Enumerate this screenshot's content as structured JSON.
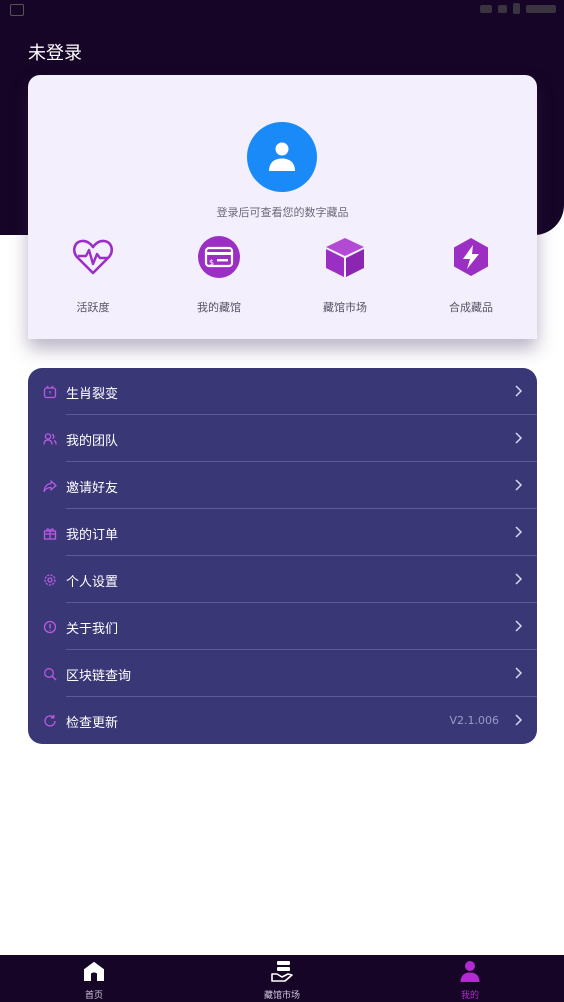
{
  "header": {
    "title": "未登录"
  },
  "profile": {
    "login_hint": "登录后可查看您的数字藏品",
    "features": [
      {
        "label": "活跃度",
        "icon": "heart-pulse-icon"
      },
      {
        "label": "我的藏馆",
        "icon": "wallet-card-icon"
      },
      {
        "label": "藏馆市场",
        "icon": "cube-box-icon"
      },
      {
        "label": "合成藏品",
        "icon": "synthesis-icon"
      }
    ]
  },
  "menu": {
    "items": [
      {
        "label": "生肖裂变",
        "icon": "alarm-clock-icon"
      },
      {
        "label": "我的团队",
        "icon": "team-icon"
      },
      {
        "label": "邀请好友",
        "icon": "share-icon"
      },
      {
        "label": "我的订单",
        "icon": "gift-icon"
      },
      {
        "label": "个人设置",
        "icon": "settings-icon"
      },
      {
        "label": "关于我们",
        "icon": "info-icon"
      },
      {
        "label": "区块链查询",
        "icon": "search-icon"
      },
      {
        "label": "检查更新",
        "icon": "refresh-icon"
      }
    ],
    "version": "V2.1.006"
  },
  "tabbar": {
    "tabs": [
      {
        "label": "首页",
        "icon": "home-icon"
      },
      {
        "label": "藏馆市场",
        "icon": "market-icon"
      },
      {
        "label": "我的",
        "icon": "user-icon",
        "active": true
      }
    ]
  },
  "colors": {
    "header_bg": "#160526",
    "menu_bg": "#3a3777",
    "accent_purple": "#9b2fc4",
    "avatar_blue": "#1a8af8",
    "active_tab": "#b02bd0"
  }
}
